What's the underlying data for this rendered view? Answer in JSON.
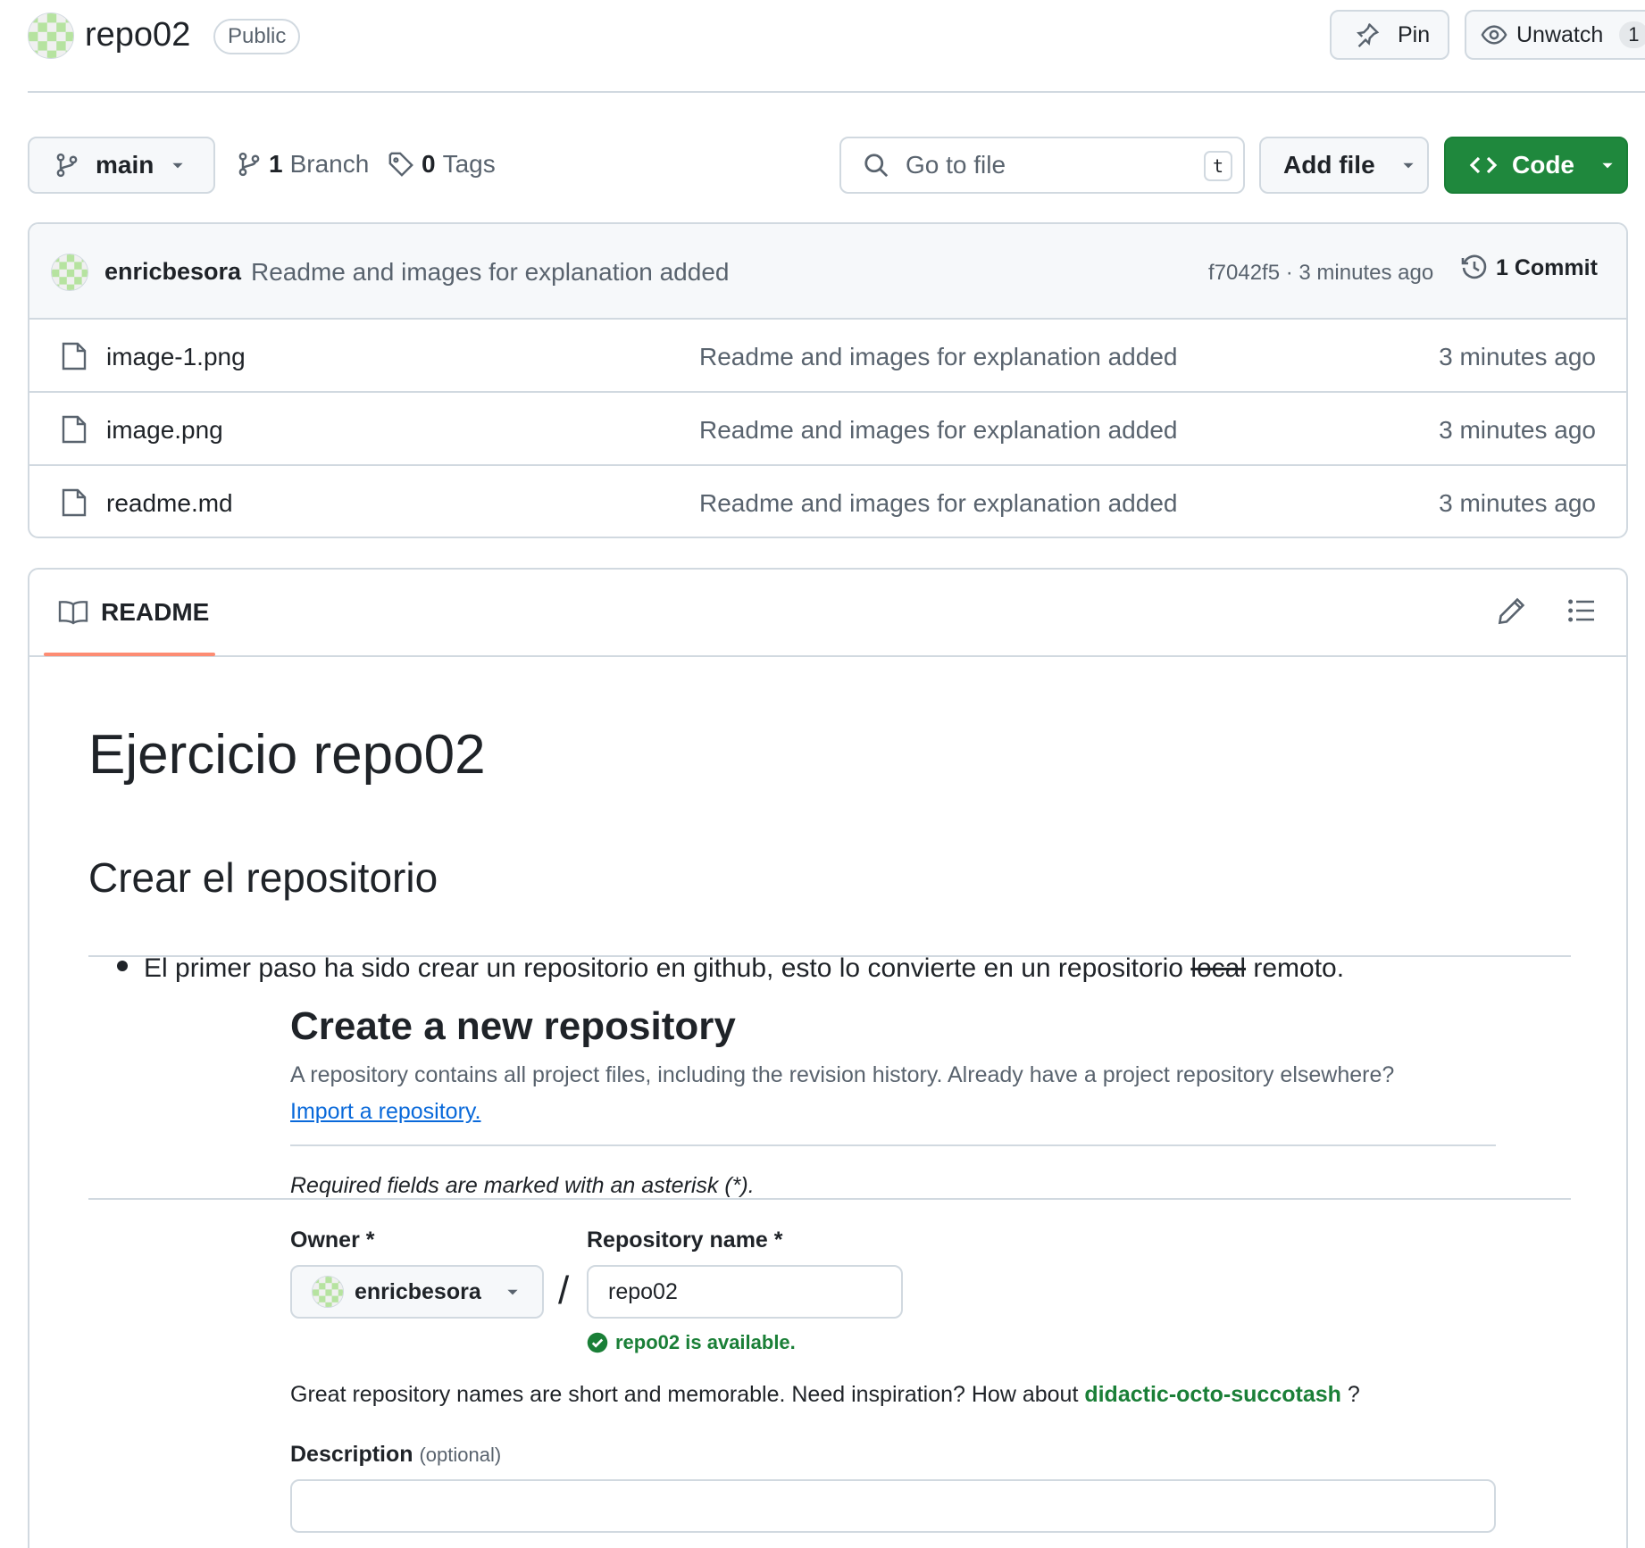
{
  "header": {
    "repo_name": "repo02",
    "visibility_badge": "Public",
    "pin_label": "Pin",
    "unwatch_label": "Unwatch",
    "watch_count": "1",
    "avatar_icon": "identicon-green"
  },
  "toolbar": {
    "branch": "main",
    "branch_count": "1",
    "branch_label": "Branch",
    "tag_count": "0",
    "tag_label": "Tags",
    "search_placeholder": "Go to file",
    "search_shortcut": "t",
    "add_file_label": "Add file",
    "code_label": "Code",
    "code_color": "#1f883d"
  },
  "latest_commit": {
    "author": "enricbesora",
    "message": "Readme and images for explanation added",
    "sha_time": "f7042f5 · 3 minutes ago",
    "commit_count_label": "1 Commit"
  },
  "files": [
    {
      "name": "image-1.png",
      "message": "Readme and images for explanation added",
      "age": "3 minutes ago"
    },
    {
      "name": "image.png",
      "message": "Readme and images for explanation added",
      "age": "3 minutes ago"
    },
    {
      "name": "readme.md",
      "message": "Readme and images for explanation added",
      "age": "3 minutes ago"
    }
  ],
  "readme": {
    "tab_label": "README",
    "h1": "Ejercicio repo02",
    "h2": "Crear el repositorio",
    "bullet_before": "El primer paso ha sido crear un repositorio en github, esto lo convierte en un repositorio ",
    "bullet_struck": "local",
    "bullet_after": " remoto.",
    "screenshot": {
      "title": "Create a new repository",
      "subtitle": "A repository contains all project files, including the revision history. Already have a project repository elsewhere?",
      "import_link": "Import a repository.",
      "required_note": "Required fields are marked with an asterisk (*).",
      "owner_label": "Owner *",
      "repo_name_label": "Repository name *",
      "owner_value": "enricbesora",
      "slash": "/",
      "repo_name_value": "repo02",
      "availability": "repo02 is available.",
      "inspiration_prefix": "Great repository names are short and memorable. Need inspiration? How about ",
      "suggestion": "didactic-octo-succotash",
      "inspiration_suffix": " ?",
      "description_label": "Description",
      "description_optional": "(optional)"
    }
  }
}
